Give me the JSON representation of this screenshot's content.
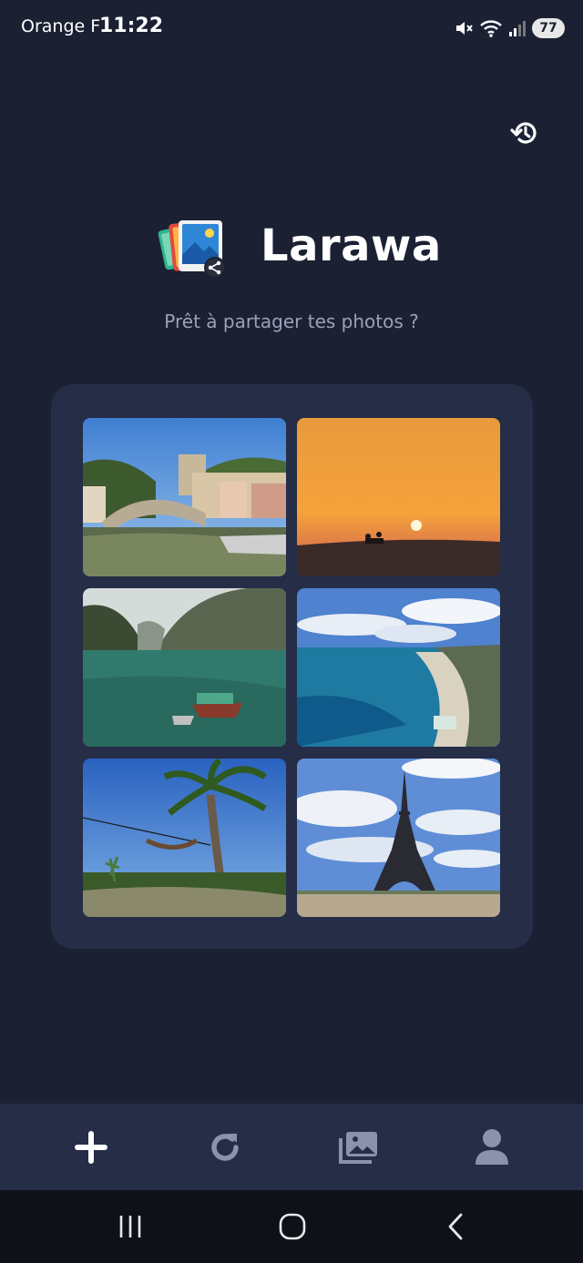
{
  "status_bar": {
    "carrier": "Orange F",
    "time": "11:22",
    "battery": "77",
    "icons": [
      "mute-icon",
      "wifi-icon",
      "signal-icon",
      "battery-icon"
    ]
  },
  "header": {
    "history_icon": "history-icon"
  },
  "brand": {
    "name": "Larawa",
    "logo_icon": "photo-share-logo",
    "subtitle": "Prêt à partager tes photos ?"
  },
  "photos": [
    {
      "subject": "village-bridge"
    },
    {
      "subject": "desert-sunset"
    },
    {
      "subject": "bay-boat"
    },
    {
      "subject": "coastline-beach"
    },
    {
      "subject": "palm-hammock"
    },
    {
      "subject": "eiffel-tower"
    }
  ],
  "bottom_nav": {
    "items": [
      {
        "icon": "plus-icon",
        "active": true
      },
      {
        "icon": "refresh-icon",
        "active": false
      },
      {
        "icon": "gallery-icon",
        "active": false
      },
      {
        "icon": "user-icon",
        "active": false
      }
    ]
  },
  "system_nav": {
    "items": [
      "recent-apps-icon",
      "home-icon",
      "back-icon"
    ]
  },
  "colors": {
    "background": "#1b2133",
    "card": "#252d47",
    "subtitle": "#9aa2b8",
    "inactive_icon": "#8a93ad"
  }
}
